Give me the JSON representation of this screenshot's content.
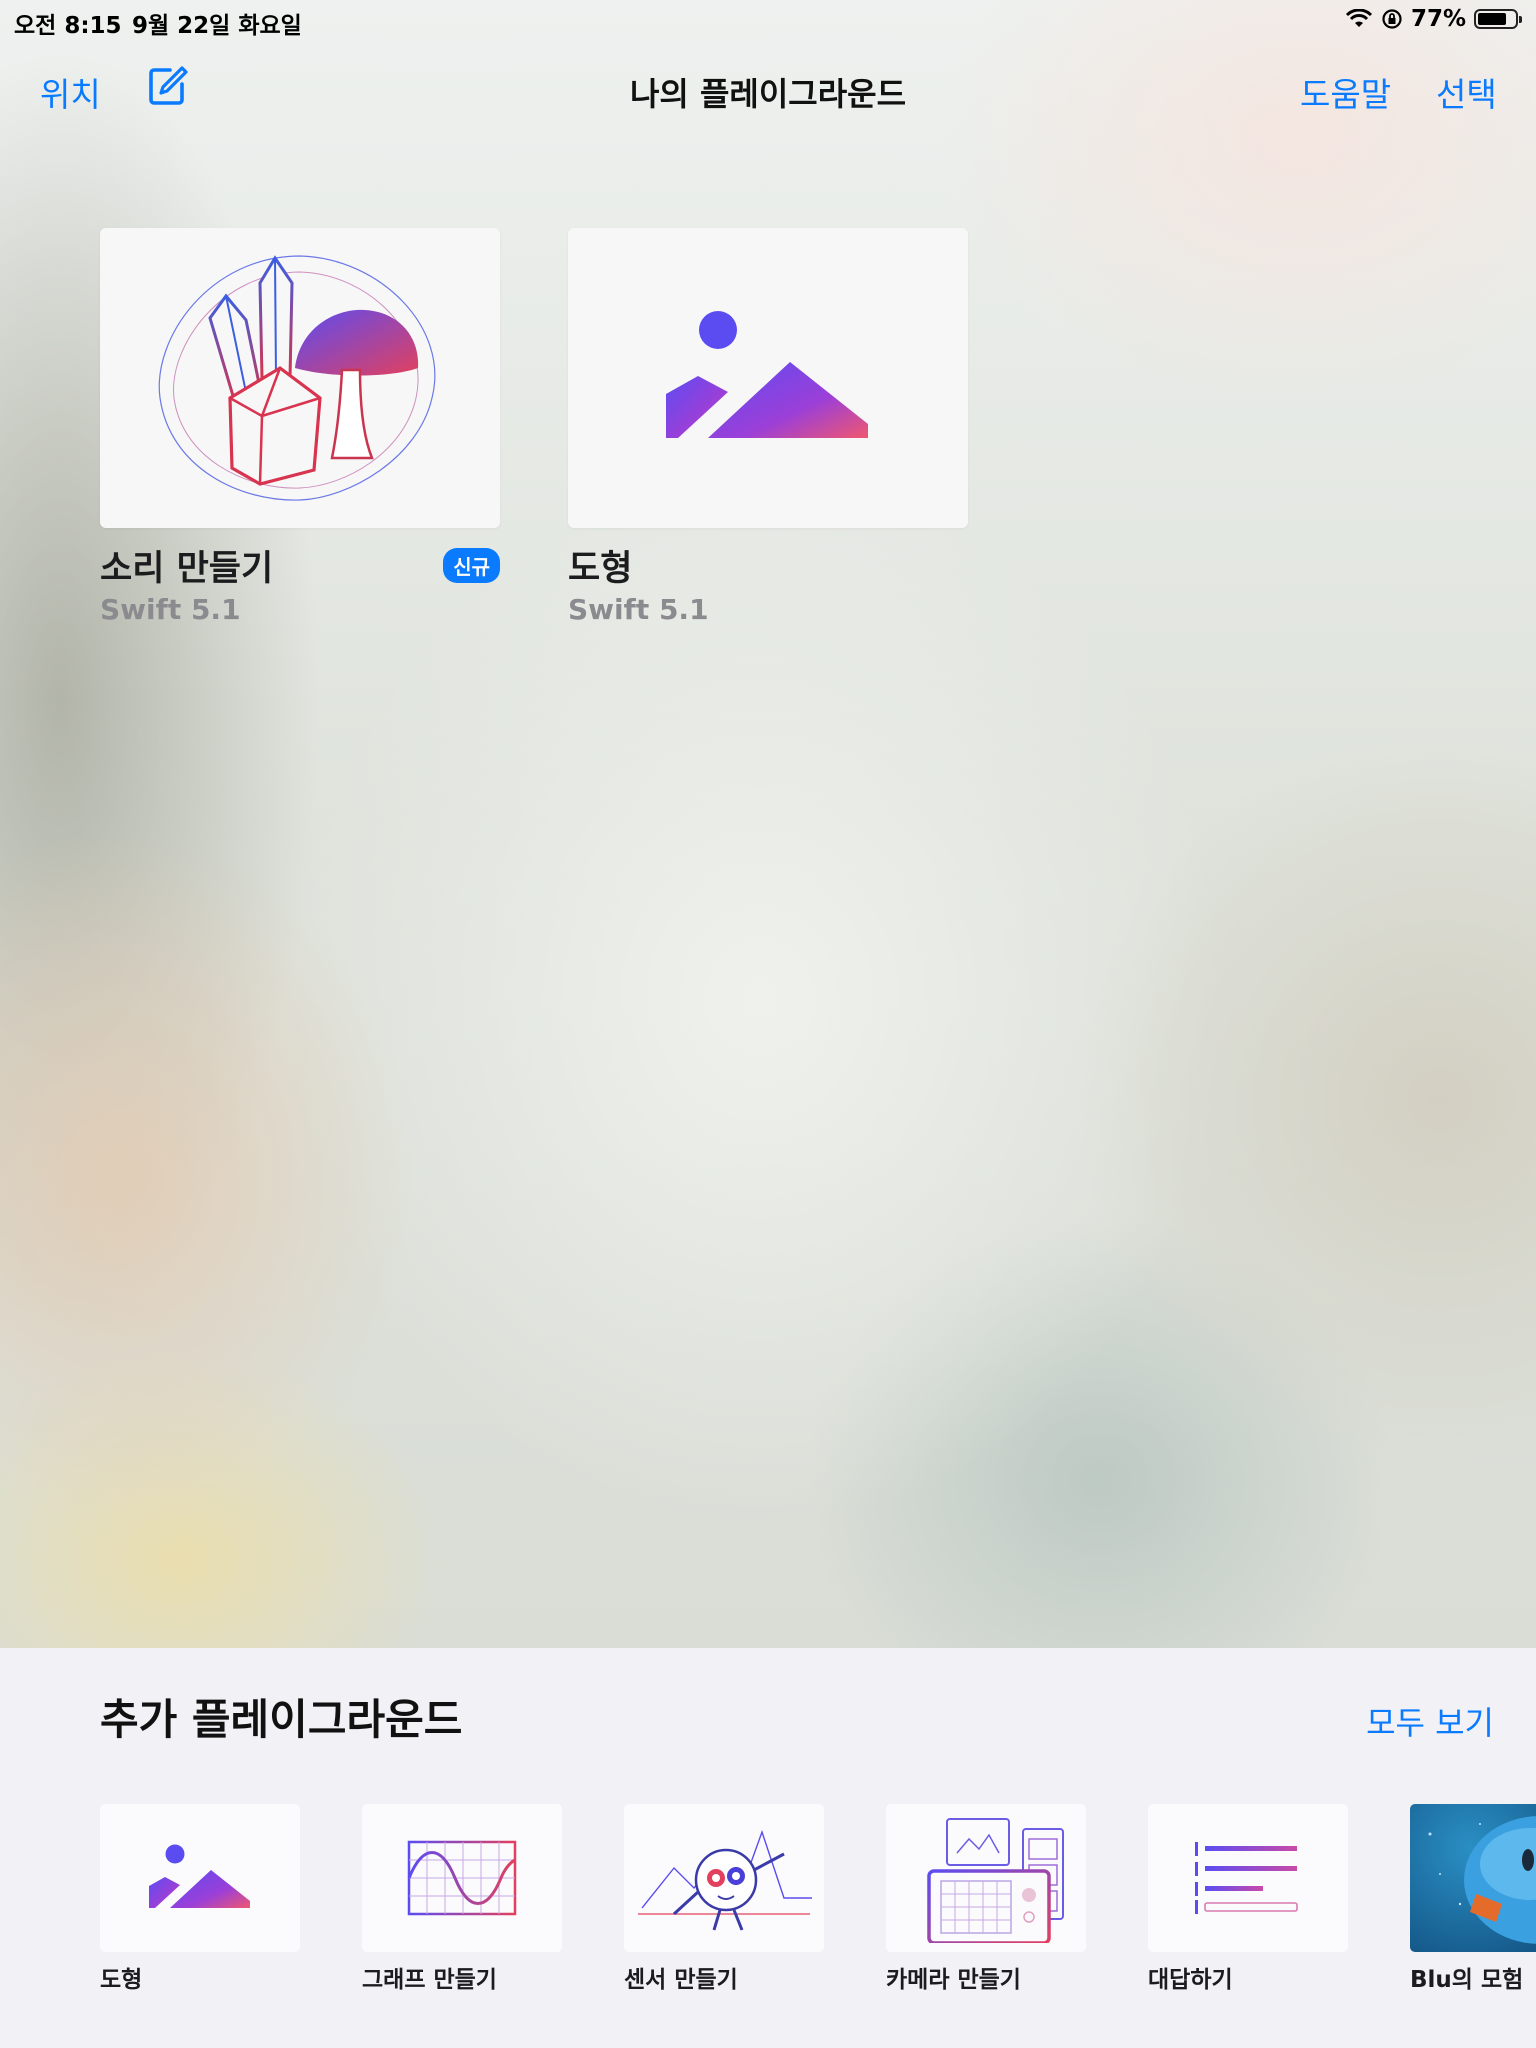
{
  "status_bar": {
    "time": "오전 8:15",
    "date": "9월 22일 화요일",
    "battery": "77%",
    "battery_level": 0.77
  },
  "nav": {
    "locations": "위치",
    "title": "나의 플레이그라운드",
    "help": "도움말",
    "select": "선택"
  },
  "my_playgrounds": [
    {
      "name": "소리 만들기",
      "version": "Swift 5.1",
      "badge": "신규",
      "icon": "crystals-mushroom-icon"
    },
    {
      "name": "도형",
      "version": "Swift 5.1",
      "icon": "shapes-mountain-icon"
    }
  ],
  "more": {
    "title": "추가 플레이그라운드",
    "see_all": "모두 보기",
    "items": [
      {
        "label": "도형",
        "icon": "shapes-mountain-icon"
      },
      {
        "label": "그래프 만들기",
        "icon": "sine-graph-icon"
      },
      {
        "label": "센서 만들기",
        "icon": "sensor-character-icon"
      },
      {
        "label": "카메라 만들기",
        "icon": "camera-windows-icon"
      },
      {
        "label": "대답하기",
        "icon": "list-lines-icon"
      },
      {
        "label": "Blu의 모험",
        "icon": "blu-character-icon"
      }
    ]
  },
  "colors": {
    "accent": "#0a7aff",
    "gradient_start": "#5b4cf2",
    "gradient_end": "#f0576f"
  }
}
